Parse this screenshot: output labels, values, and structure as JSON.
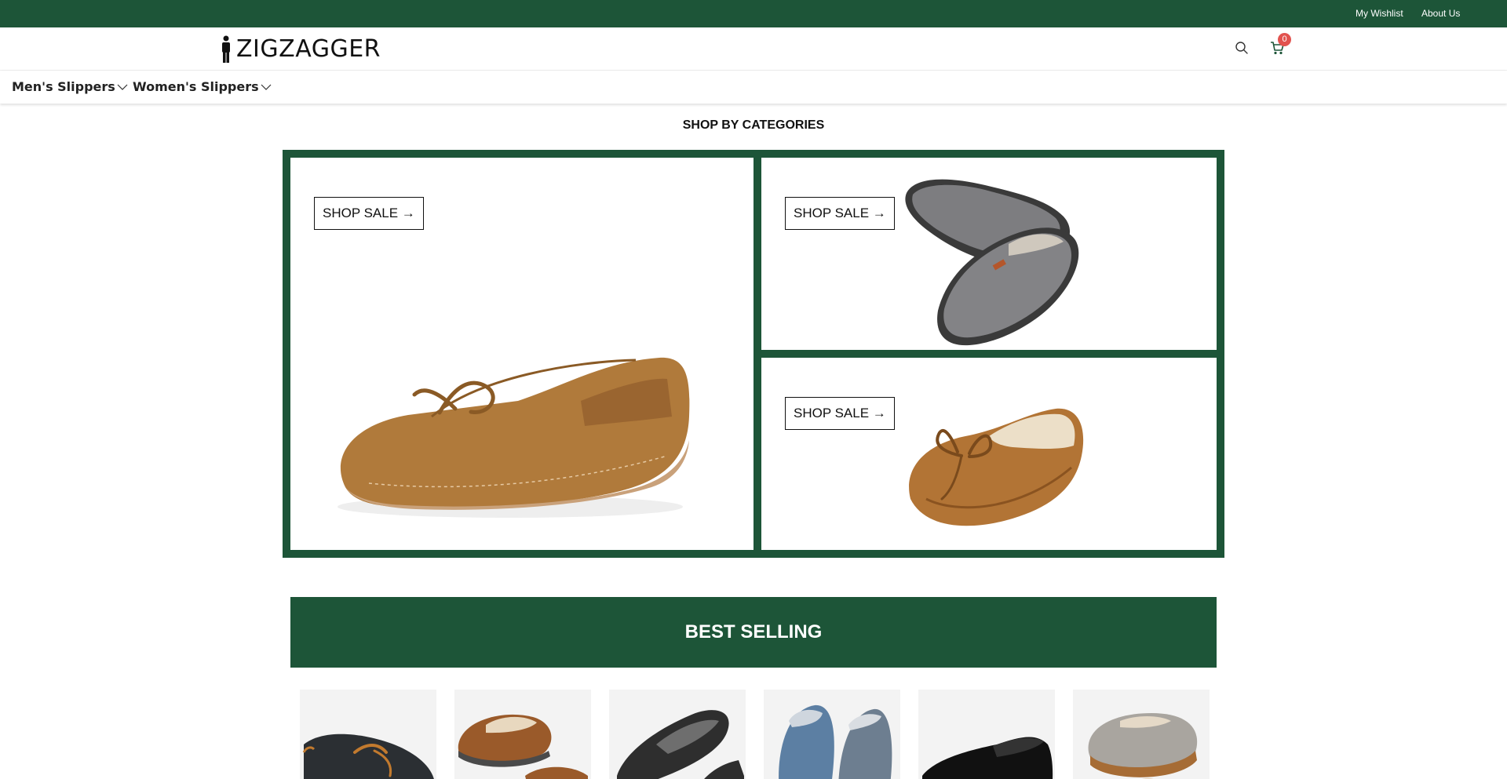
{
  "topbar": {
    "wishlist": "My Wishlist",
    "about": "About Us",
    "bg_color": "#1d5538"
  },
  "header": {
    "logo_text": "ZIGZAGGER",
    "cart_count": "0",
    "icons": [
      "person-icon",
      "search-icon",
      "cart-icon"
    ]
  },
  "nav": {
    "items": [
      {
        "label": "Men's Slippers",
        "icon": "chevron-down-icon"
      },
      {
        "label": "Women's Slippers",
        "icon": "chevron-down-icon"
      }
    ]
  },
  "categories": {
    "title": "SHOP BY CATEGORIES",
    "cards": [
      {
        "cta": "SHOP SALE →",
        "image": "tan suede moccasin slipper"
      },
      {
        "cta": "SHOP SALE →",
        "image": "grey fleece-lined slip-on slipper"
      },
      {
        "cta": "SHOP SALE →",
        "image": "tan suede moccasin with sherpa lining"
      }
    ]
  },
  "best_selling": {
    "title": "BEST SELLING",
    "products": [
      {
        "image": "black leather moccasin with tan laces"
      },
      {
        "image": "brown suede slippers pair"
      },
      {
        "image": "black and grey slip-on slippers"
      },
      {
        "image": "blue and grey slippers pair"
      },
      {
        "image": "black slip-on slipper"
      },
      {
        "image": "tweed slipper with brown trim"
      }
    ]
  },
  "colors": {
    "brand_green": "#1d5538",
    "badge_red": "#e2534f"
  }
}
